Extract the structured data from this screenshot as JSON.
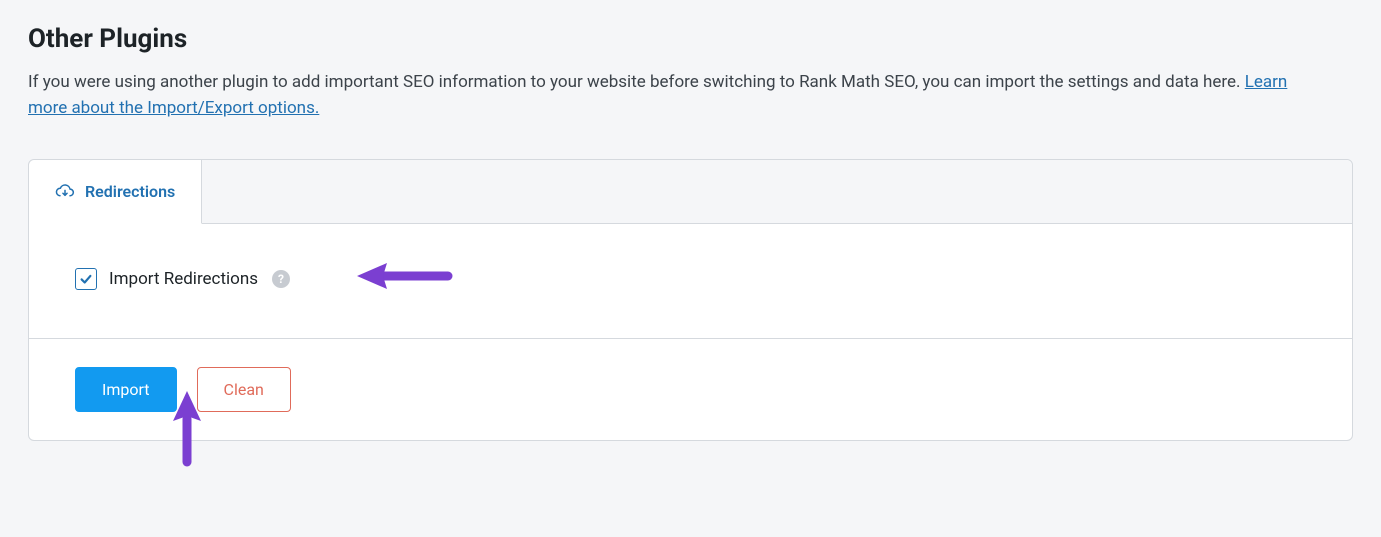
{
  "header": {
    "title": "Other Plugins",
    "description_prefix": "If you were using another plugin to add important SEO information to your website before switching to Rank Math SEO, you can import the settings and data here. ",
    "link_text": "Learn more about the Import/Export options."
  },
  "tabs": [
    {
      "label": "Redirections",
      "active": true
    }
  ],
  "content": {
    "checkbox_label": "Import Redirections",
    "checkbox_checked": true
  },
  "buttons": {
    "import_label": "Import",
    "clean_label": "Clean"
  },
  "colors": {
    "accent": "#2271b1",
    "primary_button": "#129af0",
    "danger": "#e06b5a",
    "annotation": "#7b3fd1"
  }
}
